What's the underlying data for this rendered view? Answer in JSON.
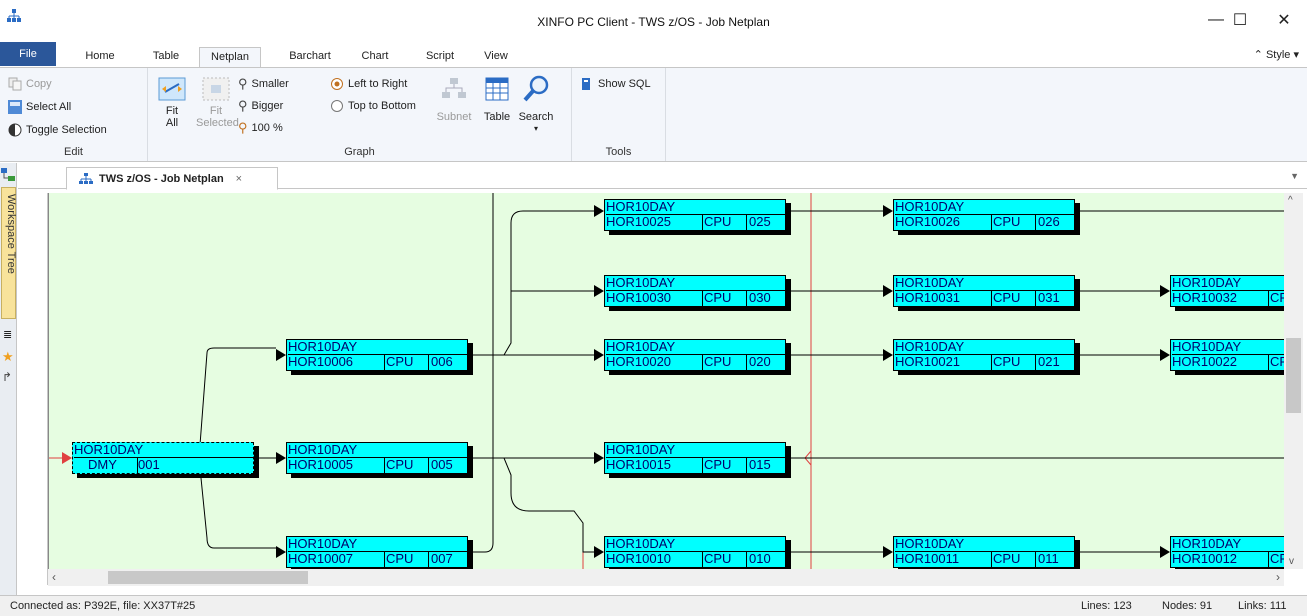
{
  "window": {
    "title": "XINFO PC Client - TWS z/OS - Job Netplan",
    "minimize": "—",
    "maximize": "☐",
    "close": "✕"
  },
  "ribbon_tabs": [
    "File",
    "Home",
    "Table",
    "Netplan",
    "Barchart",
    "Chart",
    "Script",
    "View"
  ],
  "active_tab": "Netplan",
  "style_label": "Style",
  "groups": {
    "edit": {
      "label": "Edit",
      "copy": "Copy",
      "select_all": "Select All",
      "toggle_selection": "Toggle Selection"
    },
    "graph": {
      "label": "Graph",
      "fit_all": "Fit All",
      "fit_selected": "Fit Selected",
      "smaller": "Smaller",
      "bigger": "Bigger",
      "zoom_100": "100 %",
      "left_to_right": "Left to Right",
      "top_to_bottom": "Top to Bottom",
      "subnet": "Subnet",
      "table": "Table",
      "search": "Search"
    },
    "tools": {
      "label": "Tools",
      "show_sql": "Show SQL"
    }
  },
  "side_panel": {
    "label": "Workspace Tree"
  },
  "document_tab": {
    "label": "TWS z/OS - Job Netplan",
    "close": "×"
  },
  "nodes": [
    {
      "id": "n001",
      "app": "HOR10DAY",
      "job": "DMY",
      "ws": "",
      "op": "001"
    },
    {
      "id": "n006",
      "app": "HOR10DAY",
      "job": "HOR10006",
      "ws": "CPU",
      "op": "006"
    },
    {
      "id": "n005",
      "app": "HOR10DAY",
      "job": "HOR10005",
      "ws": "CPU",
      "op": "005"
    },
    {
      "id": "n007",
      "app": "HOR10DAY",
      "job": "HOR10007",
      "ws": "CPU",
      "op": "007"
    },
    {
      "id": "n025",
      "app": "HOR10DAY",
      "job": "HOR10025",
      "ws": "CPU",
      "op": "025"
    },
    {
      "id": "n030",
      "app": "HOR10DAY",
      "job": "HOR10030",
      "ws": "CPU",
      "op": "030"
    },
    {
      "id": "n020",
      "app": "HOR10DAY",
      "job": "HOR10020",
      "ws": "CPU",
      "op": "020"
    },
    {
      "id": "n015",
      "app": "HOR10DAY",
      "job": "HOR10015",
      "ws": "CPU",
      "op": "015"
    },
    {
      "id": "n010",
      "app": "HOR10DAY",
      "job": "HOR10010",
      "ws": "CPU",
      "op": "010"
    },
    {
      "id": "n026",
      "app": "HOR10DAY",
      "job": "HOR10026",
      "ws": "CPU",
      "op": "026"
    },
    {
      "id": "n031",
      "app": "HOR10DAY",
      "job": "HOR10031",
      "ws": "CPU",
      "op": "031"
    },
    {
      "id": "n021",
      "app": "HOR10DAY",
      "job": "HOR10021",
      "ws": "CPU",
      "op": "021"
    },
    {
      "id": "n011",
      "app": "HOR10DAY",
      "job": "HOR10011",
      "ws": "CPU",
      "op": "011"
    },
    {
      "id": "n032",
      "app": "HOR10DAY",
      "job": "HOR10032",
      "ws": "CP",
      "op": ""
    },
    {
      "id": "n022",
      "app": "HOR10DAY",
      "job": "HOR10022",
      "ws": "CP",
      "op": ""
    },
    {
      "id": "n012",
      "app": "HOR10DAY",
      "job": "HOR10012",
      "ws": "CP",
      "op": ""
    }
  ],
  "status": {
    "connection": "Connected as: P392E, file: XX37T#25",
    "lines": "Lines: 123",
    "nodes": "Nodes: 91",
    "links": "Links: 111"
  },
  "colors": {
    "canvas_bg": "#e6fde1",
    "node_fill": "#00ffff",
    "node_text": "#00006a",
    "file_tab": "#2b579a",
    "divider": "#e04040"
  }
}
